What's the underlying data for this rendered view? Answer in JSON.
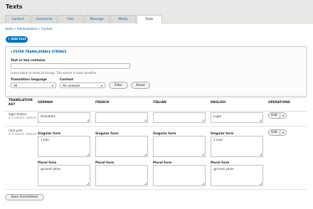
{
  "page": {
    "title": "Texts"
  },
  "tabs": [
    {
      "label": "Content"
    },
    {
      "label": "Comments"
    },
    {
      "label": "Files"
    },
    {
      "label": "Message"
    },
    {
      "label": "Media"
    },
    {
      "label": "Texts"
    }
  ],
  "breadcrumb": "Home » Administration » Content",
  "add_text": "+ Add text",
  "filter": {
    "heading": "▾ FILTER TRANSLATABLE STRINGS",
    "search_label": "Text or key contains",
    "search_value": "",
    "hint": "Leave blank to show all strings. The search is case sensitive.",
    "language_label": "Translation language",
    "language_value": "All",
    "context_label": "Context",
    "context_value": "All contexts",
    "filter_button": "Filter",
    "reset_button": "Reset"
  },
  "table": {
    "headers": {
      "key": "TRANSLATION KEY",
      "german": "GERMAN",
      "french": "FRENCH",
      "italian": "ITALIAN",
      "english": "ENGLISH",
      "operations": "OPERATIONS"
    },
    "rows": [
      {
        "key": "login.button",
        "context": "in Context: default",
        "german": "Anmelden",
        "french": "",
        "italian": "",
        "english": "Login",
        "op": "Edit"
      },
      {
        "key": "rank.year",
        "context": "in Context: default",
        "singular_label": "Singular form",
        "plural_label": "Plural form",
        "german_singular": "1 Jahr",
        "german_plural": "@count Jahre",
        "french_singular": "",
        "french_plural": "",
        "italian_singular": "",
        "italian_plural": "",
        "english_singular": "1 year",
        "english_plural": "@count years",
        "op": "Edit"
      }
    ]
  },
  "save_button": "Save translations"
}
